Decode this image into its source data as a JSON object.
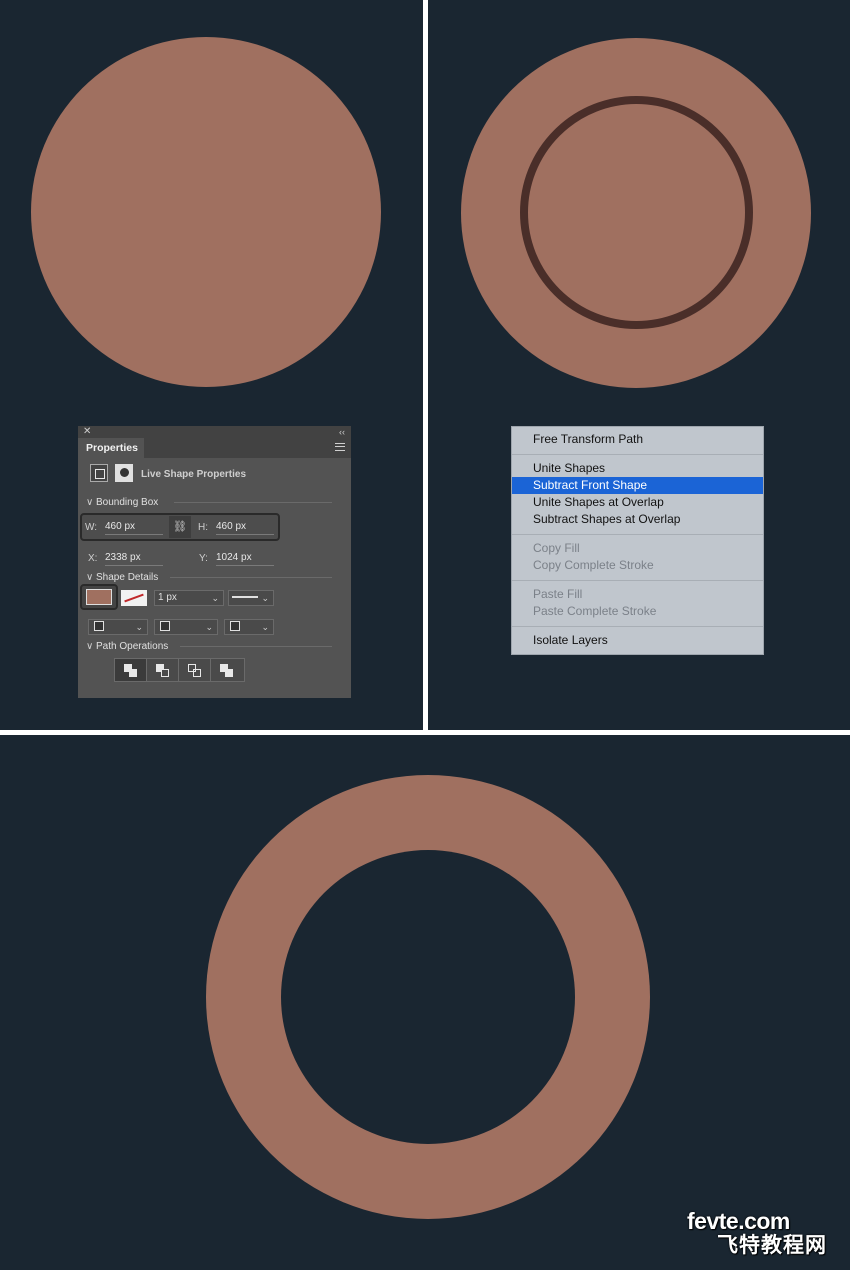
{
  "properties_panel": {
    "tab_label": "Properties",
    "subtitle": "Live Shape Properties",
    "bounding_box": {
      "heading": "Bounding Box",
      "w_label": "W:",
      "w_value": "460 px",
      "h_label": "H:",
      "h_value": "460 px",
      "x_label": "X:",
      "x_value": "2338 px",
      "y_label": "Y:",
      "y_value": "1024 px"
    },
    "shape_details": {
      "heading": "Shape Details",
      "fill_color": "#a07060",
      "stroke_width": "1 px"
    },
    "path_operations": {
      "heading": "Path Operations"
    }
  },
  "context_menu": {
    "items": [
      {
        "label": "Free Transform Path",
        "state": "normal"
      },
      {
        "label": "Unite Shapes",
        "state": "normal"
      },
      {
        "label": "Subtract Front Shape",
        "state": "selected"
      },
      {
        "label": "Unite Shapes at Overlap",
        "state": "normal"
      },
      {
        "label": "Subtract Shapes at Overlap",
        "state": "normal"
      },
      {
        "label": "Copy Fill",
        "state": "disabled"
      },
      {
        "label": "Copy Complete Stroke",
        "state": "disabled"
      },
      {
        "label": "Paste Fill",
        "state": "disabled"
      },
      {
        "label": "Paste Complete Stroke",
        "state": "disabled"
      },
      {
        "label": "Isolate Layers",
        "state": "normal"
      }
    ]
  },
  "colors": {
    "canvas_bg": "#1a2631",
    "shape_fill": "#a07060",
    "inner_stroke": "#4a2e29",
    "selection_blue": "#1b64d6"
  },
  "watermark": {
    "line1": "fevte.com",
    "line2": "飞特教程网"
  }
}
